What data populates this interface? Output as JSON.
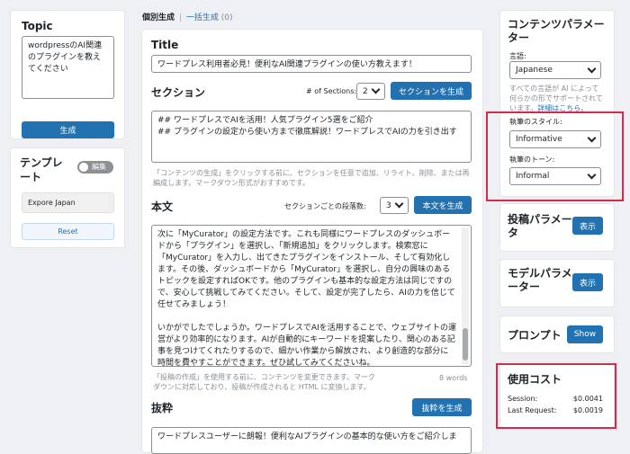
{
  "left": {
    "topic": {
      "title": "Topic",
      "value": "wordpressのAI関連のプラグインを教えてください",
      "button": "生成"
    },
    "template": {
      "title": "テンプレート",
      "toggle_label": "編集",
      "value": "Expore Japan",
      "reset": "Reset"
    }
  },
  "main": {
    "tabs": {
      "individual": "個別生成",
      "sep": "|",
      "bulk": "一括生成",
      "bulk_count": "(0)"
    },
    "title_label": "Title",
    "title_value": "ワードプレス利用者必見！便利なAI関連プラグインの使い方教えます！",
    "section": {
      "label": "セクション",
      "count_label": "# of Sections:",
      "count_value": "2",
      "button": "セクションを生成",
      "lines": [
        "## ワードプレスでAIを活用！人気プラグイン5選をご紹介",
        "## プラグインの設定から使い方まで徹底解説！ワードプレスでAIの力を引き出す"
      ],
      "hint": "「コンテンツの生成」をクリックする前に、セクションを任意で追加、リライト、削除、または再編成します。マークダウン形式がおすすめです。"
    },
    "body": {
      "label": "本文",
      "para_label": "セクションごとの段落数:",
      "para_value": "3",
      "button": "本文を生成",
      "text1": "次に「MyCurator」の設定方法です。これも同様にワードプレスのダッシュボードから「プラグイン」を選択し、「新規追加」をクリックします。検索窓に「MyCurator」を入力し、出てきたプラグインをインストール、そして有効化します。その後、ダッシュボードから「MyCurator」を選択し、自分の興味のあるトピックを設定すればOKです。他のプラグインも基本的な設定方法は同じですので、安心して挑戦してみてください。そして、設定が完了したら、AIの力を信じて任せてみましょう！",
      "text2": "いかがでしたでしょうか。ワードプレスでAIを活用することで、ウェブサイトの運営がより効率的になります。AIが自動的にキーワードを提案したり、関心のある記事を見つけてくれたりするので、細かい作業から解放され、より創造的な部分に時間を費やすことができます。ぜひ試してみてくださいね。",
      "hint": "「投稿の作成」を使用する前に、コンテンツを変更できます。マークダウンに対応しており、投稿が作成されると HTML に変換します。",
      "words": "8 words"
    },
    "excerpt": {
      "label": "抜粋",
      "button": "抜粋を生成",
      "value": "ワードプレスユーザーに朗報！便利なAIプラグインの基本的な使い方をご紹介しま"
    }
  },
  "right": {
    "content_params": {
      "title": "コンテンツパラメーター",
      "language_label": "言語:",
      "language_value": "Japanese",
      "language_hint": "すべての言語が AI によって何らかの形でサポートされています。",
      "language_link": "詳細はこちら。",
      "style_label": "執筆のスタイル:",
      "style_value": "Informative",
      "tone_label": "執筆のトーン:",
      "tone_value": "Informal"
    },
    "post_params": {
      "title": "投稿パラメータ",
      "button": "表示"
    },
    "model_params": {
      "title": "モデルパラメーター",
      "button": "表示"
    },
    "prompt": {
      "title": "プロンプト",
      "button": "Show"
    },
    "usage": {
      "title": "使用コスト",
      "session_label": "Session:",
      "session_value": "$0.0041",
      "last_label": "Last Request:",
      "last_value": "$0.0019"
    }
  },
  "colors": {
    "accent": "#2271b1",
    "highlight": "#d9294a"
  }
}
